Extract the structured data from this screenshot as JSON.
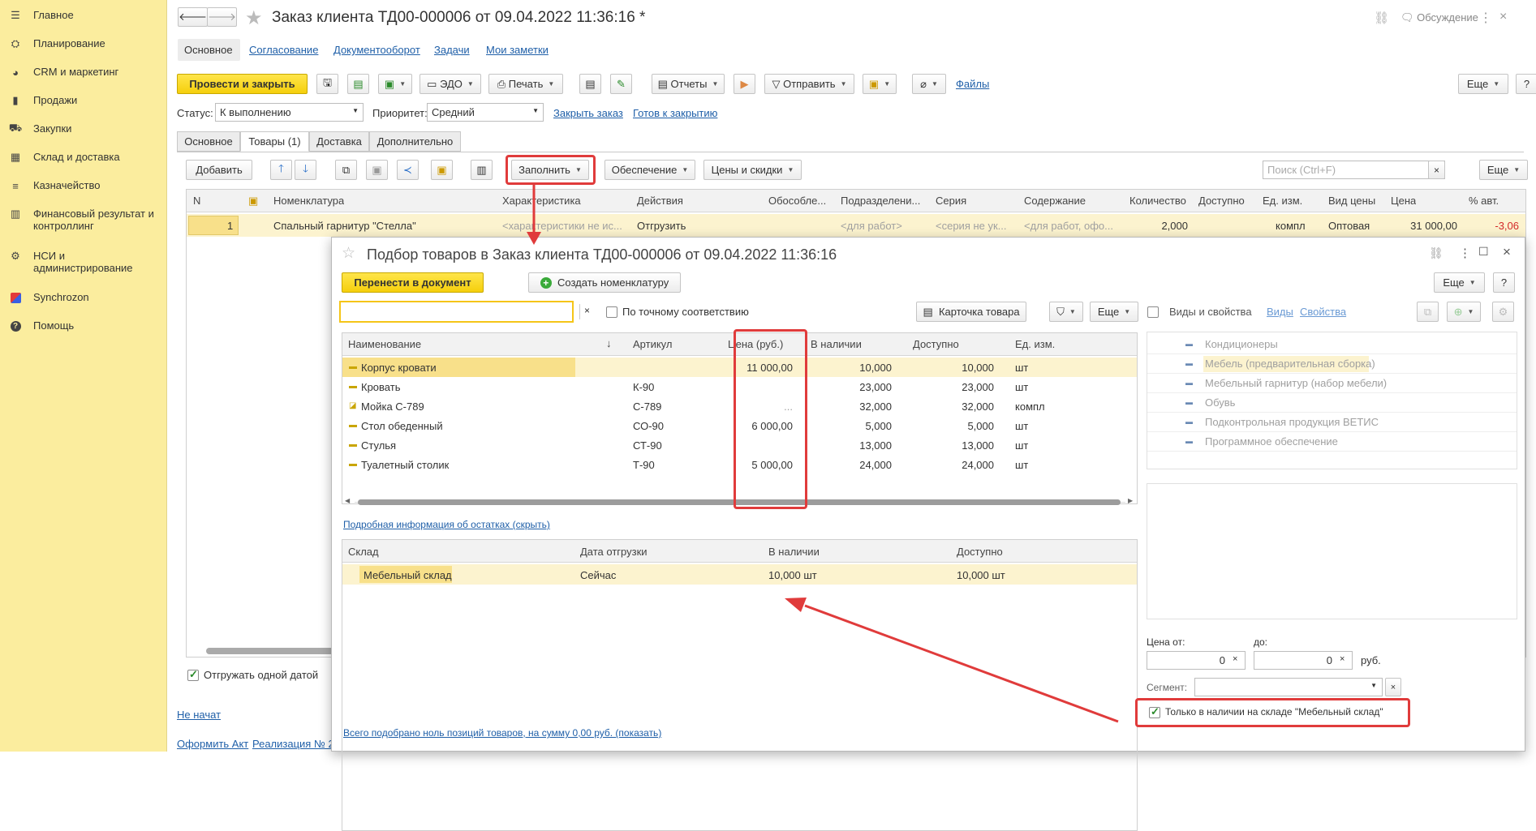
{
  "sidebar": {
    "items": [
      {
        "label": "Главное",
        "icon": "menu-icon"
      },
      {
        "label": "Планирование",
        "icon": "planning-icon"
      },
      {
        "label": "CRM и маркетинг",
        "icon": "crm-icon"
      },
      {
        "label": "Продажи",
        "icon": "sales-icon"
      },
      {
        "label": "Закупки",
        "icon": "cart-icon"
      },
      {
        "label": "Склад и доставка",
        "icon": "warehouse-icon"
      },
      {
        "label": "Казначейство",
        "icon": "treasury-icon"
      },
      {
        "label": "Финансовый результат и контроллинг",
        "icon": "chart-icon"
      },
      {
        "label": "НСИ и администрирование",
        "icon": "gear-icon"
      },
      {
        "label": "Synchrozon",
        "icon": "synchrozon-icon"
      },
      {
        "label": "Помощь",
        "icon": "help-icon"
      }
    ]
  },
  "document": {
    "title": "Заказ клиента ТД00-000006 от 09.04.2022 11:36:16 *",
    "discussion": "Обсуждение",
    "nav_tabs": [
      "Основное",
      "Согласование",
      "Документооборот",
      "Задачи",
      "Мои заметки"
    ],
    "toolbar": {
      "post_close": "Провести и закрыть",
      "edo": "ЭДО",
      "print": "Печать",
      "reports": "Отчеты",
      "send": "Отправить",
      "files": "Файлы",
      "more": "Еще"
    },
    "status_label": "Статус:",
    "status_value": "К выполнению",
    "priority_label": "Приоритет:",
    "priority_value": "Средний",
    "close_order": "Закрыть заказ",
    "ready_to_close": "Готов к закрытию",
    "content_tabs": [
      "Основное",
      "Товары (1)",
      "Доставка",
      "Дополнительно"
    ],
    "goods_toolbar": {
      "add": "Добавить",
      "fill": "Заполнить",
      "provision": "Обеспечение",
      "prices": "Цены и скидки",
      "search_placeholder": "Поиск (Ctrl+F)",
      "more": "Еще"
    },
    "table": {
      "headers": [
        "N",
        "Номенклатура",
        "Характеристика",
        "Действия",
        "Обособле...",
        "Подразделени...",
        "Серия",
        "Содержание",
        "Количество",
        "Доступно",
        "Ед. изм.",
        "Вид цены",
        "Цена",
        "% авт."
      ],
      "row": {
        "n": "1",
        "item": "Спальный гарнитур \"Стелла\"",
        "characteristic": "<характеристики не ис...",
        "action": "Отгрузить",
        "division": "<для работ>",
        "series": "<серия не ук...",
        "content": "<для работ, офо...",
        "quantity": "2,000",
        "unit": "компл",
        "price_type": "Оптовая",
        "price": "31 000,00",
        "auto_pct": "-3,06"
      }
    },
    "ship_one_date": "Отгружать одной датой",
    "not_started": "Не начат",
    "bottom_links": [
      "Оформить Акт",
      "Реализация № 2"
    ]
  },
  "picker": {
    "title": "Подбор товаров в Заказ клиента ТД00-000006 от 09.04.2022 11:36:16",
    "transfer": "Перенести в документ",
    "create_item": "Создать номенклатуру",
    "more": "Еще",
    "help": "?",
    "exact_match": "По точному соответствию",
    "product_card": "Карточка товара",
    "kinds_props": "Виды и свойства",
    "kinds": "Виды",
    "props": "Свойства",
    "headers": [
      "Наименование",
      "Артикул",
      "Цена (руб.)",
      "В наличии",
      "Доступно",
      "Ед. изм."
    ],
    "rows": [
      {
        "name": "Корпус кровати",
        "article": "",
        "price": "11 000,00",
        "stock": "10,000",
        "available": "10,000",
        "unit": "шт"
      },
      {
        "name": "Кровать",
        "article": "К-90",
        "price": "",
        "stock": "23,000",
        "available": "23,000",
        "unit": "шт"
      },
      {
        "name": "Мойка С-789",
        "article": "С-789",
        "price": "...",
        "stock": "32,000",
        "available": "32,000",
        "unit": "компл"
      },
      {
        "name": "Стол обеденный",
        "article": "СО-90",
        "price": "6 000,00",
        "stock": "5,000",
        "available": "5,000",
        "unit": "шт"
      },
      {
        "name": "Стулья",
        "article": "СТ-90",
        "price": "",
        "stock": "13,000",
        "available": "13,000",
        "unit": "шт"
      },
      {
        "name": "Туалетный столик",
        "article": "Т-90",
        "price": "5 000,00",
        "stock": "24,000",
        "available": "24,000",
        "unit": "шт"
      }
    ],
    "detail_link": "Подробная информация об остатках (скрыть)",
    "stock_headers": [
      "Склад",
      "Дата отгрузки",
      "В наличии",
      "Доступно"
    ],
    "stock_row": {
      "warehouse": "Мебельный склад",
      "date": "Сейчас",
      "stock": "10,000 шт",
      "available": "10,000 шт"
    },
    "categories": [
      "Кондиционеры",
      "Мебель (предварительная сборка)",
      "Мебельный гарнитур (набор мебели)",
      "Обувь",
      "Подконтрольная продукция ВЕТИС",
      "Программное обеспечение"
    ],
    "price_from_label": "Цена от:",
    "price_to_label": "до:",
    "price_from": "0",
    "price_to": "0",
    "currency": "руб.",
    "segment_label": "Сегмент:",
    "only_in_stock": "Только в наличии на складе \"Мебельный склад\"",
    "summary": "Всего подобрано ноль позиций товаров, на сумму 0,00 руб. (показать)"
  }
}
